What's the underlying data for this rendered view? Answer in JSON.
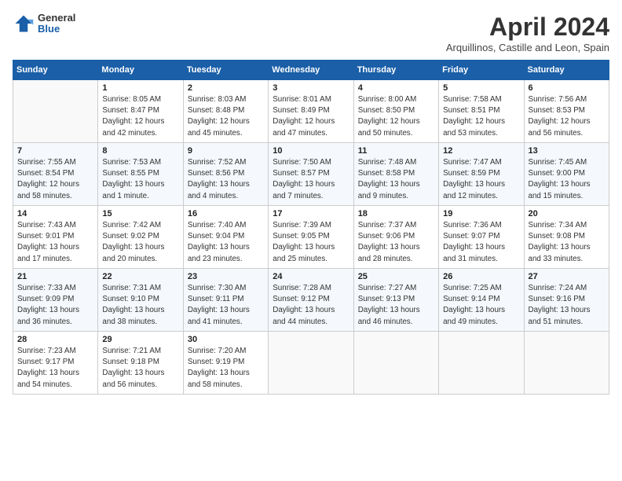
{
  "header": {
    "title": "April 2024",
    "location": "Arquillinos, Castille and Leon, Spain",
    "logo_general": "General",
    "logo_blue": "Blue"
  },
  "days_of_week": [
    "Sunday",
    "Monday",
    "Tuesday",
    "Wednesday",
    "Thursday",
    "Friday",
    "Saturday"
  ],
  "weeks": [
    [
      {
        "day": "",
        "empty": true
      },
      {
        "day": "1",
        "sunrise": "Sunrise: 8:05 AM",
        "sunset": "Sunset: 8:47 PM",
        "daylight": "Daylight: 12 hours and 42 minutes."
      },
      {
        "day": "2",
        "sunrise": "Sunrise: 8:03 AM",
        "sunset": "Sunset: 8:48 PM",
        "daylight": "Daylight: 12 hours and 45 minutes."
      },
      {
        "day": "3",
        "sunrise": "Sunrise: 8:01 AM",
        "sunset": "Sunset: 8:49 PM",
        "daylight": "Daylight: 12 hours and 47 minutes."
      },
      {
        "day": "4",
        "sunrise": "Sunrise: 8:00 AM",
        "sunset": "Sunset: 8:50 PM",
        "daylight": "Daylight: 12 hours and 50 minutes."
      },
      {
        "day": "5",
        "sunrise": "Sunrise: 7:58 AM",
        "sunset": "Sunset: 8:51 PM",
        "daylight": "Daylight: 12 hours and 53 minutes."
      },
      {
        "day": "6",
        "sunrise": "Sunrise: 7:56 AM",
        "sunset": "Sunset: 8:53 PM",
        "daylight": "Daylight: 12 hours and 56 minutes."
      }
    ],
    [
      {
        "day": "7",
        "sunrise": "Sunrise: 7:55 AM",
        "sunset": "Sunset: 8:54 PM",
        "daylight": "Daylight: 12 hours and 58 minutes."
      },
      {
        "day": "8",
        "sunrise": "Sunrise: 7:53 AM",
        "sunset": "Sunset: 8:55 PM",
        "daylight": "Daylight: 13 hours and 1 minute."
      },
      {
        "day": "9",
        "sunrise": "Sunrise: 7:52 AM",
        "sunset": "Sunset: 8:56 PM",
        "daylight": "Daylight: 13 hours and 4 minutes."
      },
      {
        "day": "10",
        "sunrise": "Sunrise: 7:50 AM",
        "sunset": "Sunset: 8:57 PM",
        "daylight": "Daylight: 13 hours and 7 minutes."
      },
      {
        "day": "11",
        "sunrise": "Sunrise: 7:48 AM",
        "sunset": "Sunset: 8:58 PM",
        "daylight": "Daylight: 13 hours and 9 minutes."
      },
      {
        "day": "12",
        "sunrise": "Sunrise: 7:47 AM",
        "sunset": "Sunset: 8:59 PM",
        "daylight": "Daylight: 13 hours and 12 minutes."
      },
      {
        "day": "13",
        "sunrise": "Sunrise: 7:45 AM",
        "sunset": "Sunset: 9:00 PM",
        "daylight": "Daylight: 13 hours and 15 minutes."
      }
    ],
    [
      {
        "day": "14",
        "sunrise": "Sunrise: 7:43 AM",
        "sunset": "Sunset: 9:01 PM",
        "daylight": "Daylight: 13 hours and 17 minutes."
      },
      {
        "day": "15",
        "sunrise": "Sunrise: 7:42 AM",
        "sunset": "Sunset: 9:02 PM",
        "daylight": "Daylight: 13 hours and 20 minutes."
      },
      {
        "day": "16",
        "sunrise": "Sunrise: 7:40 AM",
        "sunset": "Sunset: 9:04 PM",
        "daylight": "Daylight: 13 hours and 23 minutes."
      },
      {
        "day": "17",
        "sunrise": "Sunrise: 7:39 AM",
        "sunset": "Sunset: 9:05 PM",
        "daylight": "Daylight: 13 hours and 25 minutes."
      },
      {
        "day": "18",
        "sunrise": "Sunrise: 7:37 AM",
        "sunset": "Sunset: 9:06 PM",
        "daylight": "Daylight: 13 hours and 28 minutes."
      },
      {
        "day": "19",
        "sunrise": "Sunrise: 7:36 AM",
        "sunset": "Sunset: 9:07 PM",
        "daylight": "Daylight: 13 hours and 31 minutes."
      },
      {
        "day": "20",
        "sunrise": "Sunrise: 7:34 AM",
        "sunset": "Sunset: 9:08 PM",
        "daylight": "Daylight: 13 hours and 33 minutes."
      }
    ],
    [
      {
        "day": "21",
        "sunrise": "Sunrise: 7:33 AM",
        "sunset": "Sunset: 9:09 PM",
        "daylight": "Daylight: 13 hours and 36 minutes."
      },
      {
        "day": "22",
        "sunrise": "Sunrise: 7:31 AM",
        "sunset": "Sunset: 9:10 PM",
        "daylight": "Daylight: 13 hours and 38 minutes."
      },
      {
        "day": "23",
        "sunrise": "Sunrise: 7:30 AM",
        "sunset": "Sunset: 9:11 PM",
        "daylight": "Daylight: 13 hours and 41 minutes."
      },
      {
        "day": "24",
        "sunrise": "Sunrise: 7:28 AM",
        "sunset": "Sunset: 9:12 PM",
        "daylight": "Daylight: 13 hours and 44 minutes."
      },
      {
        "day": "25",
        "sunrise": "Sunrise: 7:27 AM",
        "sunset": "Sunset: 9:13 PM",
        "daylight": "Daylight: 13 hours and 46 minutes."
      },
      {
        "day": "26",
        "sunrise": "Sunrise: 7:25 AM",
        "sunset": "Sunset: 9:14 PM",
        "daylight": "Daylight: 13 hours and 49 minutes."
      },
      {
        "day": "27",
        "sunrise": "Sunrise: 7:24 AM",
        "sunset": "Sunset: 9:16 PM",
        "daylight": "Daylight: 13 hours and 51 minutes."
      }
    ],
    [
      {
        "day": "28",
        "sunrise": "Sunrise: 7:23 AM",
        "sunset": "Sunset: 9:17 PM",
        "daylight": "Daylight: 13 hours and 54 minutes."
      },
      {
        "day": "29",
        "sunrise": "Sunrise: 7:21 AM",
        "sunset": "Sunset: 9:18 PM",
        "daylight": "Daylight: 13 hours and 56 minutes."
      },
      {
        "day": "30",
        "sunrise": "Sunrise: 7:20 AM",
        "sunset": "Sunset: 9:19 PM",
        "daylight": "Daylight: 13 hours and 58 minutes."
      },
      {
        "day": "",
        "empty": true
      },
      {
        "day": "",
        "empty": true
      },
      {
        "day": "",
        "empty": true
      },
      {
        "day": "",
        "empty": true
      }
    ]
  ]
}
